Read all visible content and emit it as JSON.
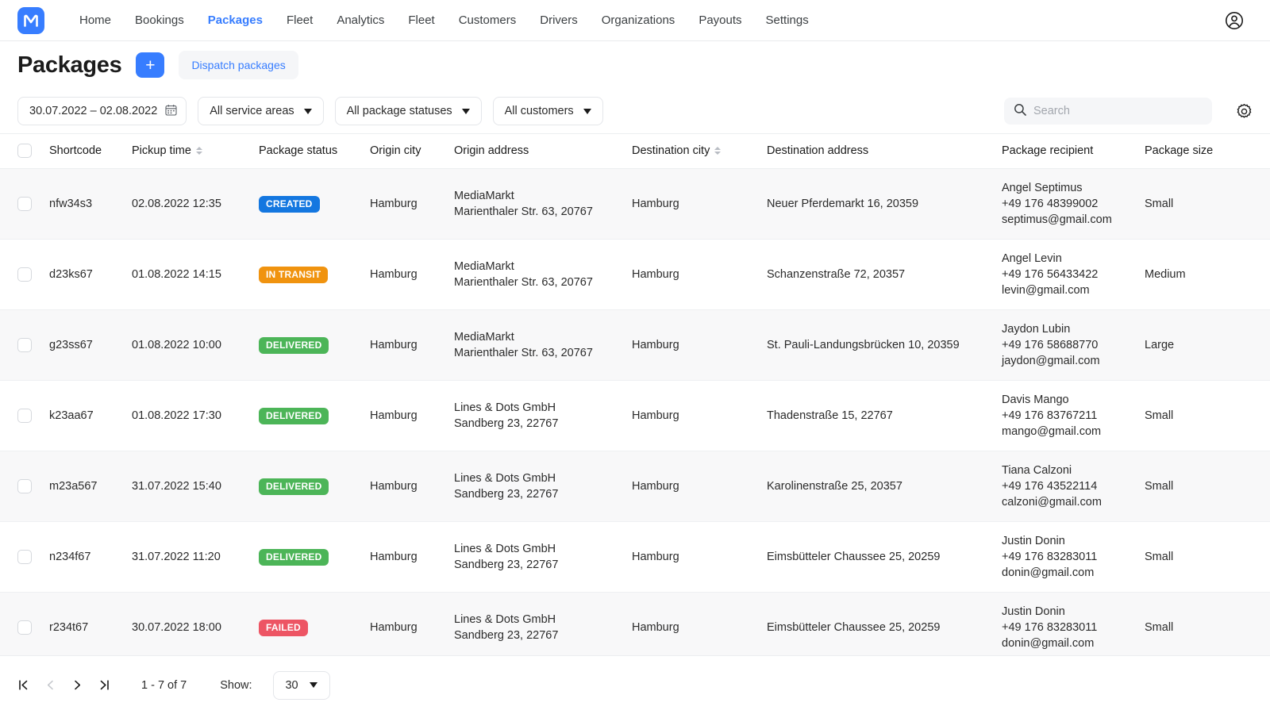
{
  "nav": {
    "logo_letter": "M",
    "logo_color": "#377dff",
    "items": [
      {
        "label": "Home",
        "active": false
      },
      {
        "label": "Bookings",
        "active": false
      },
      {
        "label": "Packages",
        "active": true
      },
      {
        "label": "Fleet",
        "active": false
      },
      {
        "label": "Analytics",
        "active": false
      },
      {
        "label": "Fleet",
        "active": false
      },
      {
        "label": "Customers",
        "active": false
      },
      {
        "label": "Drivers",
        "active": false
      },
      {
        "label": "Organizations",
        "active": false
      },
      {
        "label": "Payouts",
        "active": false
      },
      {
        "label": "Settings",
        "active": false
      }
    ],
    "account_icon": "account-circle-icon"
  },
  "header": {
    "title": "Packages",
    "add_label": "+",
    "dispatch_label": "Dispatch packages"
  },
  "filters": {
    "date_range": "30.07.2022 – 02.08.2022",
    "calendar_icon": "calendar-icon",
    "service_areas": "All service areas",
    "package_statuses": "All package statuses",
    "customers": "All customers",
    "search_placeholder": "Search",
    "search_value": "",
    "search_icon": "search-icon",
    "settings_icon": "gear-icon"
  },
  "table": {
    "columns": [
      {
        "key": "checkbox",
        "label": "",
        "sortable": false
      },
      {
        "key": "shortcode",
        "label": "Shortcode",
        "sortable": false
      },
      {
        "key": "pickup_time",
        "label": "Pickup time",
        "sortable": true
      },
      {
        "key": "package_status",
        "label": "Package status",
        "sortable": false
      },
      {
        "key": "origin_city",
        "label": "Origin city",
        "sortable": false
      },
      {
        "key": "origin_address",
        "label": "Origin address",
        "sortable": false
      },
      {
        "key": "destination_city",
        "label": "Destination city",
        "sortable": true
      },
      {
        "key": "destination_address",
        "label": "Destination address",
        "sortable": false
      },
      {
        "key": "package_recipient",
        "label": "Package recipient",
        "sortable": false
      },
      {
        "key": "package_size",
        "label": "Package size",
        "sortable": false
      }
    ],
    "rows": [
      {
        "shortcode": "nfw34s3",
        "pickup_time": "02.08.2022 12:35",
        "status_label": "CREATED",
        "status_key": "created",
        "origin_city": "Hamburg",
        "origin_name": "MediaMarkt",
        "origin_street": "Marienthaler Str. 63, 20767",
        "destination_city": "Hamburg",
        "destination_address": "Neuer Pferdemarkt 16, 20359",
        "recipient_name": "Angel Septimus",
        "recipient_phone": "+49 176 48399002",
        "recipient_email": "septimus@gmail.com",
        "package_size": "Small"
      },
      {
        "shortcode": "d23ks67",
        "pickup_time": "01.08.2022 14:15",
        "status_label": "IN TRANSIT",
        "status_key": "in_transit",
        "origin_city": "Hamburg",
        "origin_name": "MediaMarkt",
        "origin_street": "Marienthaler Str. 63, 20767",
        "destination_city": "Hamburg",
        "destination_address": "Schanzenstraße 72, 20357",
        "recipient_name": "Angel Levin",
        "recipient_phone": "+49 176 56433422",
        "recipient_email": "levin@gmail.com",
        "package_size": "Medium"
      },
      {
        "shortcode": "g23ss67",
        "pickup_time": "01.08.2022 10:00",
        "status_label": "DELIVERED",
        "status_key": "delivered",
        "origin_city": "Hamburg",
        "origin_name": "MediaMarkt",
        "origin_street": "Marienthaler Str. 63, 20767",
        "destination_city": "Hamburg",
        "destination_address": "St. Pauli-Landungsbrücken 10, 20359",
        "recipient_name": "Jaydon Lubin",
        "recipient_phone": "+49 176 58688770",
        "recipient_email": "jaydon@gmail.com",
        "package_size": "Large"
      },
      {
        "shortcode": "k23aa67",
        "pickup_time": "01.08.2022 17:30",
        "status_label": "DELIVERED",
        "status_key": "delivered",
        "origin_city": "Hamburg",
        "origin_name": "Lines & Dots GmbH",
        "origin_street": "Sandberg 23, 22767",
        "destination_city": "Hamburg",
        "destination_address": "Thadenstraße 15, 22767",
        "recipient_name": "Davis Mango",
        "recipient_phone": "+49 176 83767211",
        "recipient_email": "mango@gmail.com",
        "package_size": "Small"
      },
      {
        "shortcode": "m23a567",
        "pickup_time": "31.07.2022 15:40",
        "status_label": "DELIVERED",
        "status_key": "delivered",
        "origin_city": "Hamburg",
        "origin_name": "Lines & Dots GmbH",
        "origin_street": "Sandberg 23, 22767",
        "destination_city": "Hamburg",
        "destination_address": "Karolinenstraße 25, 20357",
        "recipient_name": "Tiana Calzoni",
        "recipient_phone": "+49 176 43522114",
        "recipient_email": "calzoni@gmail.com",
        "package_size": "Small"
      },
      {
        "shortcode": "n234f67",
        "pickup_time": "31.07.2022 11:20",
        "status_label": "DELIVERED",
        "status_key": "delivered",
        "origin_city": "Hamburg",
        "origin_name": "Lines & Dots GmbH",
        "origin_street": "Sandberg 23, 22767",
        "destination_city": "Hamburg",
        "destination_address": "Eimsbütteler Chaussee 25, 20259",
        "recipient_name": "Justin Donin",
        "recipient_phone": "+49 176 83283011",
        "recipient_email": "donin@gmail.com",
        "package_size": "Small"
      },
      {
        "shortcode": "r234t67",
        "pickup_time": "30.07.2022 18:00",
        "status_label": "FAILED",
        "status_key": "failed",
        "origin_city": "Hamburg",
        "origin_name": "Lines & Dots GmbH",
        "origin_street": "Sandberg 23, 22767",
        "destination_city": "Hamburg",
        "destination_address": "Eimsbütteler Chaussee 25, 20259",
        "recipient_name": "Justin Donin",
        "recipient_phone": "+49 176 83283011",
        "recipient_email": "donin@gmail.com",
        "package_size": "Small"
      }
    ]
  },
  "footer": {
    "first_icon": "first-page-icon",
    "prev_icon": "previous-page-icon",
    "next_icon": "next-page-icon",
    "last_icon": "last-page-icon",
    "range": "1 - 7 of 7",
    "show_label": "Show:",
    "page_size": "30"
  },
  "colors": {
    "accent": "#377dff",
    "created": "#1477e0",
    "in_transit": "#f0930f",
    "delivered": "#4cb558",
    "failed": "#ed5564"
  }
}
